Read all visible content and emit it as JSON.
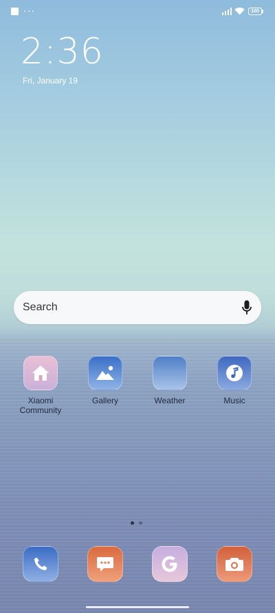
{
  "status_bar": {
    "dots": "···",
    "battery_level": "100"
  },
  "clock": {
    "time": "2:36",
    "date": "Fri, January 19"
  },
  "search": {
    "placeholder": "Search"
  },
  "apps": [
    {
      "label": "Xiaomi Community",
      "icon": "house-icon"
    },
    {
      "label": "Gallery",
      "icon": "landscape-icon"
    },
    {
      "label": "Weather",
      "icon": "weather-icon"
    },
    {
      "label": "Music",
      "icon": "music-note-icon"
    }
  ],
  "page_indicator": {
    "current_page": 1,
    "total_pages": 2
  },
  "dock": [
    {
      "name": "Phone",
      "icon": "phone-icon"
    },
    {
      "name": "Messages",
      "icon": "message-bubble-icon"
    },
    {
      "name": "Google",
      "icon": "google-g-icon"
    },
    {
      "name": "Camera",
      "icon": "camera-icon"
    }
  ],
  "colors": {
    "label_text": "#222a40",
    "search_bg": "#f7f8fa"
  }
}
